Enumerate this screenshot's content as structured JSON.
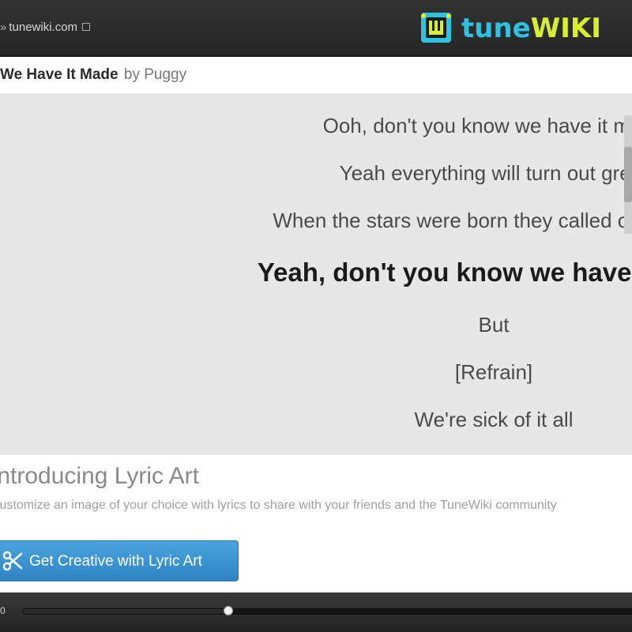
{
  "header": {
    "site_prefix": "»",
    "site_link": "tunewiki.com",
    "logo": {
      "text_part1": "tune",
      "text_part2": "WIKI",
      "colors": {
        "cyan": "#2fc2e0",
        "lime": "#d8ef2a"
      }
    }
  },
  "song": {
    "title": "We Have It Made",
    "by_label": "by Puggy"
  },
  "lyrics": {
    "lines": [
      "Ooh, don't you know we have it made",
      "Yeah everything will turn out great",
      "When the stars were born they called our names",
      "Yeah, don't you know we have it made",
      "But",
      "[Refrain]",
      "We're sick of it all"
    ],
    "current_index": 3
  },
  "promo": {
    "heading": "Introducing Lyric Art",
    "description": "Customize an image of your choice with lyrics to share with your friends and the TuneWiki community",
    "button_label": "Get Creative with Lyric Art",
    "button_icon": "scissors-icon",
    "accent": "#3a93d2"
  },
  "player": {
    "time_fragment": "0",
    "progress_fraction": 0.33
  }
}
